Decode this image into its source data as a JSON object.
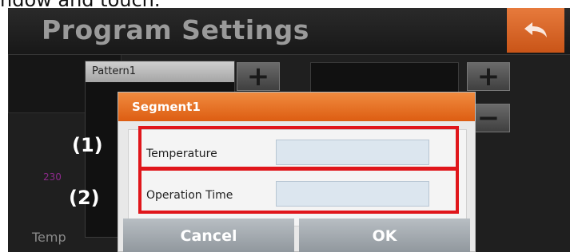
{
  "caption": "ndow and touch.",
  "app": {
    "title": "Program Settings"
  },
  "patterns": [
    "Pattern1"
  ],
  "buttons": {
    "add_pattern": "+",
    "add_segment": "+",
    "remove_segment": "−"
  },
  "graph": {
    "y_tick": "230",
    "axis_label": "Temp"
  },
  "dialog": {
    "title": "Segment1",
    "fields": [
      {
        "label": "Temperature",
        "value": ""
      },
      {
        "label": "Operation Time",
        "value": ""
      }
    ],
    "cancel_label": "Cancel",
    "ok_label": "OK"
  },
  "callouts": [
    "(1)",
    "(2)"
  ],
  "colors": {
    "accent": "#e56f2b",
    "highlight": "#e0161b"
  }
}
